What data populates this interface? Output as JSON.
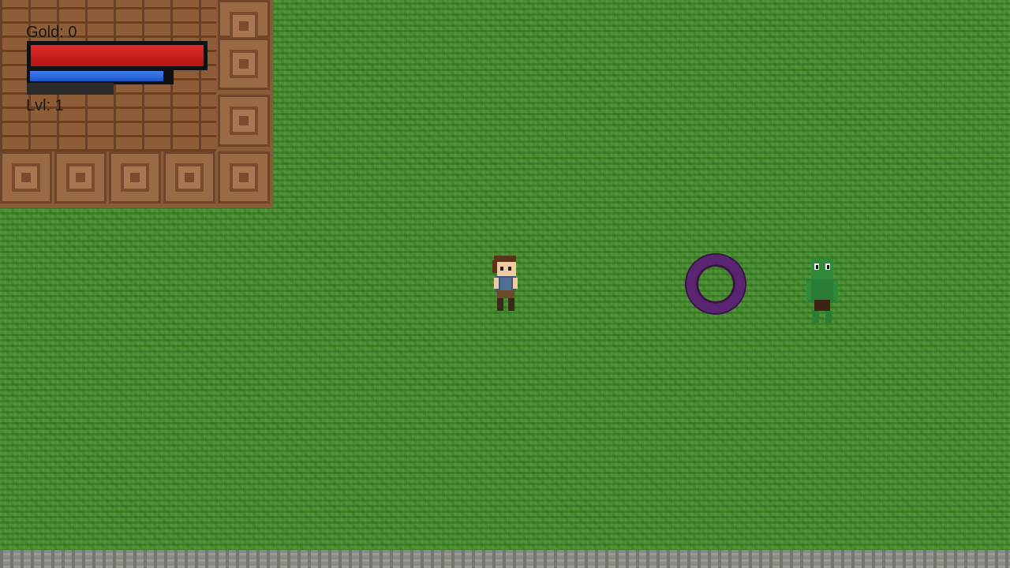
{
  "hud": {
    "gold_text": "Gold: 0",
    "level_text": "Lvl: 1",
    "health_fraction": 1.0,
    "mana_fraction": 0.95,
    "xp_fraction": 0.0
  },
  "colors": {
    "grass": "#4a8f34",
    "brick": "#8e5c37",
    "health": "#d42020",
    "mana": "#2e6ce0",
    "portal": "#5a2470",
    "orc": "#2f8a3a"
  },
  "entities": {
    "player": "player-character",
    "portal": "purple-portal-ring",
    "enemy": "green-orc-enemy"
  }
}
